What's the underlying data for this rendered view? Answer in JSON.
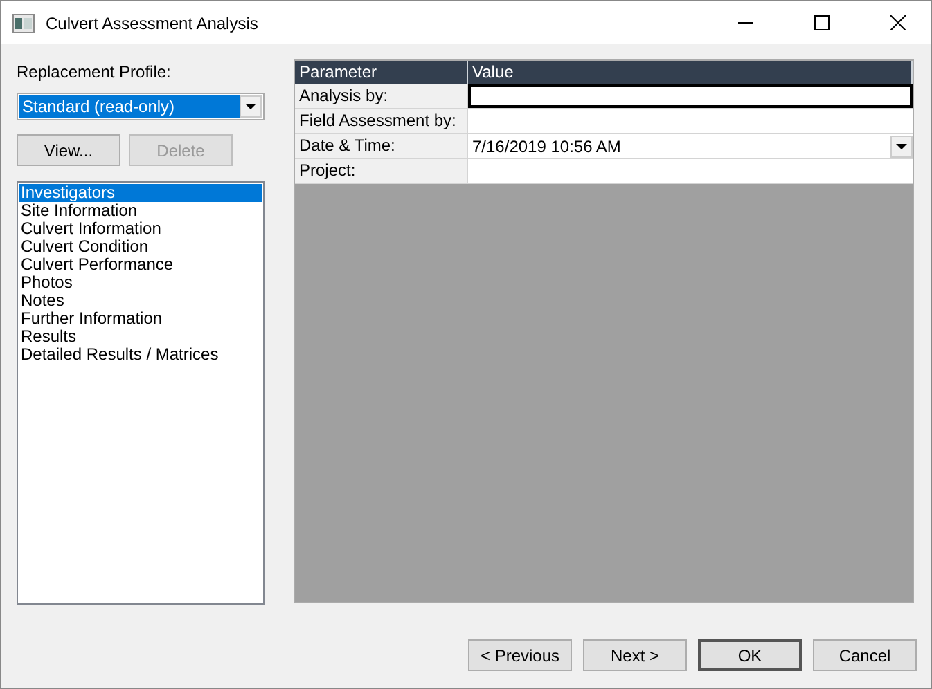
{
  "window": {
    "title": "Culvert Assessment Analysis"
  },
  "profile": {
    "label": "Replacement Profile:",
    "value": "Standard (read-only)"
  },
  "profile_buttons": [
    {
      "label": "View...",
      "disabled": false
    },
    {
      "label": "Delete",
      "disabled": true
    }
  ],
  "sections": [
    {
      "label": "Investigators",
      "selected": true
    },
    {
      "label": "Site Information",
      "selected": false
    },
    {
      "label": "Culvert Information",
      "selected": false
    },
    {
      "label": "Culvert Condition",
      "selected": false
    },
    {
      "label": "Culvert Performance",
      "selected": false
    },
    {
      "label": "Photos",
      "selected": false
    },
    {
      "label": "Notes",
      "selected": false
    },
    {
      "label": "Further Information",
      "selected": false
    },
    {
      "label": "Results",
      "selected": false
    },
    {
      "label": "Detailed Results / Matrices",
      "selected": false
    }
  ],
  "grid": {
    "columns": [
      "Parameter",
      "Value"
    ],
    "rows": [
      {
        "parameter": "Analysis by:",
        "kind": "text",
        "focused": true
      },
      {
        "parameter": "Field Assessment by:",
        "kind": "text",
        "focused": false
      },
      {
        "parameter": "Date & Time:",
        "kind": "dropdown",
        "value": "7/16/2019 10:56 AM",
        "focused": false
      },
      {
        "parameter": "Project:",
        "kind": "text",
        "focused": false
      }
    ]
  },
  "footer_buttons": [
    {
      "label": "< Previous",
      "default": false
    },
    {
      "label": "Next >",
      "default": false
    },
    {
      "label": "OK",
      "default": true
    },
    {
      "label": "Cancel",
      "default": false
    }
  ]
}
